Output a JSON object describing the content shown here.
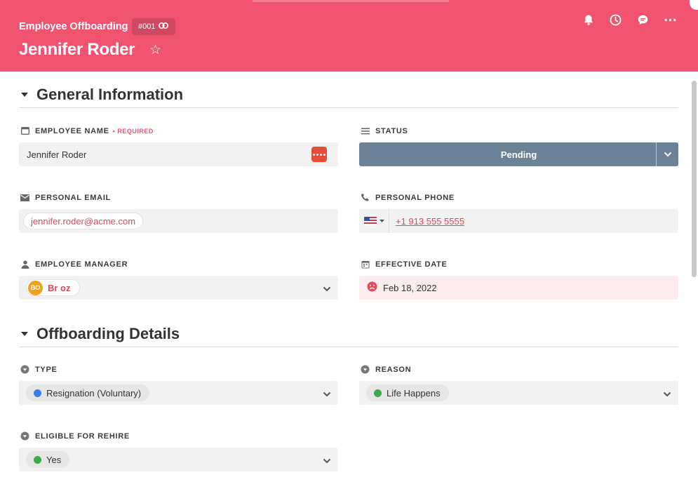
{
  "header": {
    "subtitle": "Employee Offboarding",
    "record_id": "#001",
    "title": "Jennifer Roder",
    "star": "☆"
  },
  "sections": {
    "general": "General Information",
    "offboarding": "Offboarding Details"
  },
  "fields": {
    "employee_name": {
      "label": "EMPLOYEE NAME",
      "required": "• REQUIRED",
      "value": "Jennifer Roder"
    },
    "status": {
      "label": "STATUS",
      "value": "Pending"
    },
    "personal_email": {
      "label": "PERSONAL EMAIL",
      "value": "jennifer.roder@acme.com"
    },
    "personal_phone": {
      "label": "PERSONAL PHONE",
      "value": "+1 913 555 5555"
    },
    "employee_manager": {
      "label": "EMPLOYEE MANAGER",
      "initials": "BO",
      "value": "Br oz"
    },
    "effective_date": {
      "label": "EFFECTIVE DATE",
      "value": "Feb 18, 2022"
    },
    "type": {
      "label": "TYPE",
      "value": "Resignation (Voluntary)",
      "color": "#3b7de8"
    },
    "reason": {
      "label": "REASON",
      "value": "Life Happens",
      "color": "#3aab47"
    },
    "eligible_rehire": {
      "label": "ELIGIBLE FOR REHIRE",
      "value": "Yes",
      "color": "#3aab47"
    }
  },
  "colors": {
    "header_bg": "#ef5370",
    "status_bg": "#6c8297",
    "accent": "#e0475e"
  }
}
